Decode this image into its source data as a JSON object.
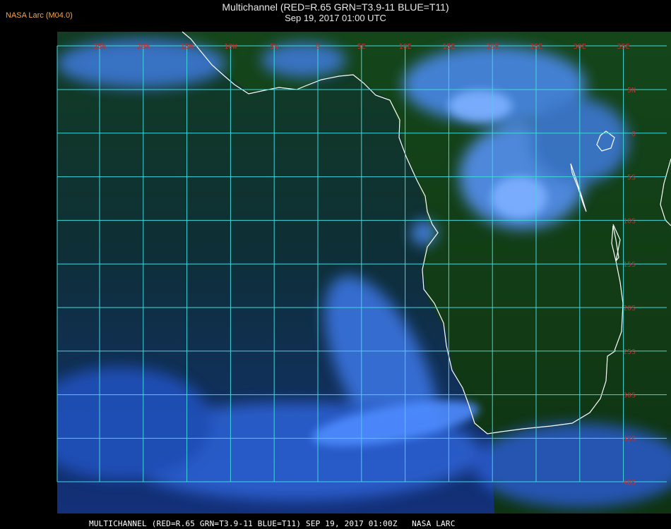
{
  "header": {
    "source_tag": "NASA Larc (M04.0)",
    "title": "Multichannel (RED=R.65 GRN=T3.9-11 BLUE=T11)",
    "datetime": "Sep 19, 2017 01:00 UTC"
  },
  "footer": {
    "caption": "MULTICHANNEL (RED=R.65 GRN=T3.9-11 BLUE=T11) SEP 19, 2017 01:00Z   NASA LARC"
  },
  "map": {
    "longitude_labels": [
      "25W",
      "20W",
      "15W",
      "10W",
      "5W",
      "0",
      "5E",
      "10E",
      "15E",
      "20E",
      "25E",
      "30E",
      "35E"
    ],
    "latitude_labels": [
      "5N",
      "0",
      "5S",
      "10S",
      "15S",
      "20S",
      "25S",
      "30S",
      "35S",
      "40S"
    ],
    "colors": {
      "grid": "#3fd8dc",
      "grid_label": "#c23030",
      "coastline": "#ffffff",
      "ocean_dark": "#0d2a3a",
      "land": "#123d14",
      "cloud": "#4f8cff",
      "frame_background": "#000000"
    }
  }
}
